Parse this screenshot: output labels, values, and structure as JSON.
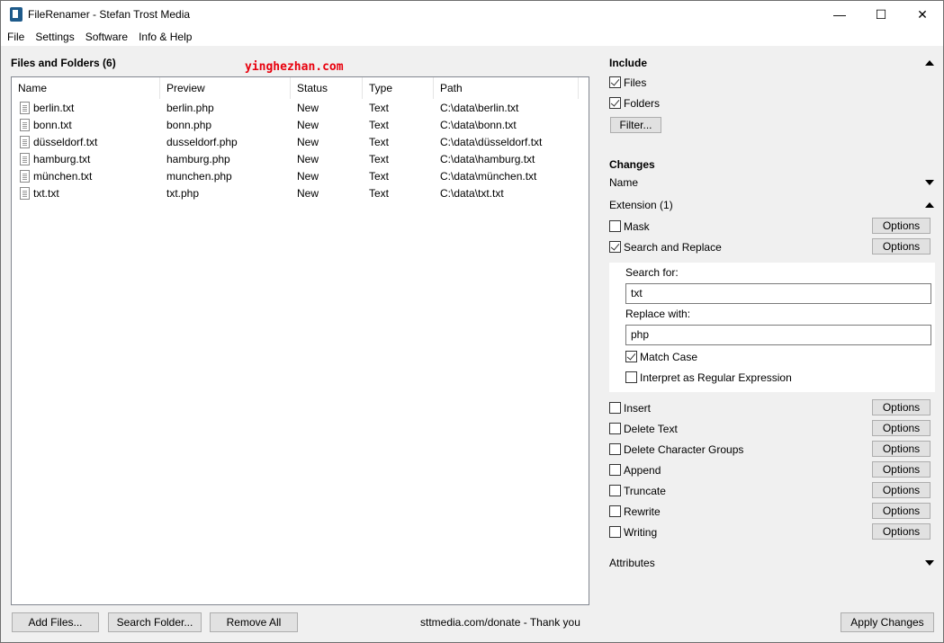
{
  "window": {
    "title": "FileRenamer - Stefan Trost Media",
    "controls": {
      "minimize": "—",
      "maximize": "☐",
      "close": "✕"
    }
  },
  "menu": [
    "File",
    "Settings",
    "Software",
    "Info & Help"
  ],
  "files_panel": {
    "title": "Files and Folders (6)",
    "columns": [
      "Name",
      "Preview",
      "Status",
      "Type",
      "Path"
    ],
    "rows": [
      {
        "name": "berlin.txt",
        "preview": "berlin.php",
        "status": "New",
        "type": "Text",
        "path": "C:\\data\\berlin.txt"
      },
      {
        "name": "bonn.txt",
        "preview": "bonn.php",
        "status": "New",
        "type": "Text",
        "path": "C:\\data\\bonn.txt"
      },
      {
        "name": "düsseldorf.txt",
        "preview": "dusseldorf.php",
        "status": "New",
        "type": "Text",
        "path": "C:\\data\\düsseldorf.txt"
      },
      {
        "name": "hamburg.txt",
        "preview": "hamburg.php",
        "status": "New",
        "type": "Text",
        "path": "C:\\data\\hamburg.txt"
      },
      {
        "name": "münchen.txt",
        "preview": "munchen.php",
        "status": "New",
        "type": "Text",
        "path": "C:\\data\\münchen.txt"
      },
      {
        "name": "txt.txt",
        "preview": "txt.php",
        "status": "New",
        "type": "Text",
        "path": "C:\\data\\txt.txt"
      }
    ]
  },
  "watermark": "yinghezhan.com",
  "bottom": {
    "add_files": "Add Files...",
    "search_folder": "Search Folder...",
    "remove_all": "Remove All",
    "donate_text": "sttmedia.com/donate - Thank you",
    "apply": "Apply Changes"
  },
  "include": {
    "title": "Include",
    "files": {
      "label": "Files",
      "checked": true
    },
    "folders": {
      "label": "Folders",
      "checked": true
    },
    "filter_button": "Filter..."
  },
  "changes": {
    "title": "Changes",
    "name_label": "Name",
    "extension_label": "Extension (1)",
    "options_label": "Options",
    "mask": {
      "label": "Mask",
      "checked": false
    },
    "search_replace": {
      "label": "Search and Replace",
      "checked": true,
      "search_for_label": "Search for:",
      "search_for_value": "txt",
      "replace_with_label": "Replace with:",
      "replace_with_value": "php",
      "match_case": {
        "label": "Match Case",
        "checked": true
      },
      "regex": {
        "label": "Interpret as Regular Expression",
        "checked": false
      }
    },
    "items": [
      {
        "label": "Insert",
        "checked": false
      },
      {
        "label": "Delete Text",
        "checked": false
      },
      {
        "label": "Delete Character Groups",
        "checked": false
      },
      {
        "label": "Append",
        "checked": false
      },
      {
        "label": "Truncate",
        "checked": false
      },
      {
        "label": "Rewrite",
        "checked": false
      },
      {
        "label": "Writing",
        "checked": false
      }
    ],
    "attributes_label": "Attributes"
  }
}
